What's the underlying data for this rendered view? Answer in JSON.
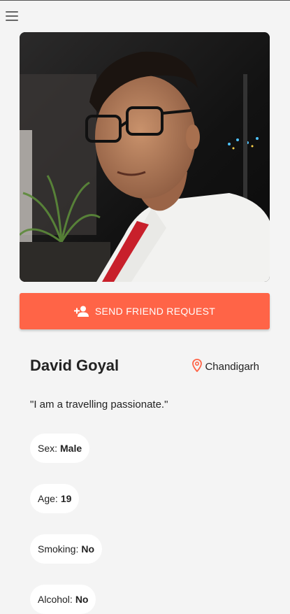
{
  "header": {
    "menu_icon": "hamburger-menu-icon"
  },
  "profile": {
    "photo_alt": "Profile photo",
    "cta_label": "SEND FRIEND REQUEST",
    "cta_icon": "person-add-icon",
    "name": "David Goyal",
    "location": "Chandigarh",
    "location_icon": "location-pin-icon",
    "bio": "\"I am a travelling passionate.\"",
    "attributes": [
      {
        "label": "Sex:",
        "value": "Male"
      },
      {
        "label": "Age:",
        "value": "19"
      },
      {
        "label": "Smoking:",
        "value": "No"
      },
      {
        "label": "Alcohol:",
        "value": "No"
      }
    ]
  },
  "colors": {
    "accent": "#ff6447",
    "background": "#f4f4f4",
    "pill_bg": "#ffffff"
  }
}
